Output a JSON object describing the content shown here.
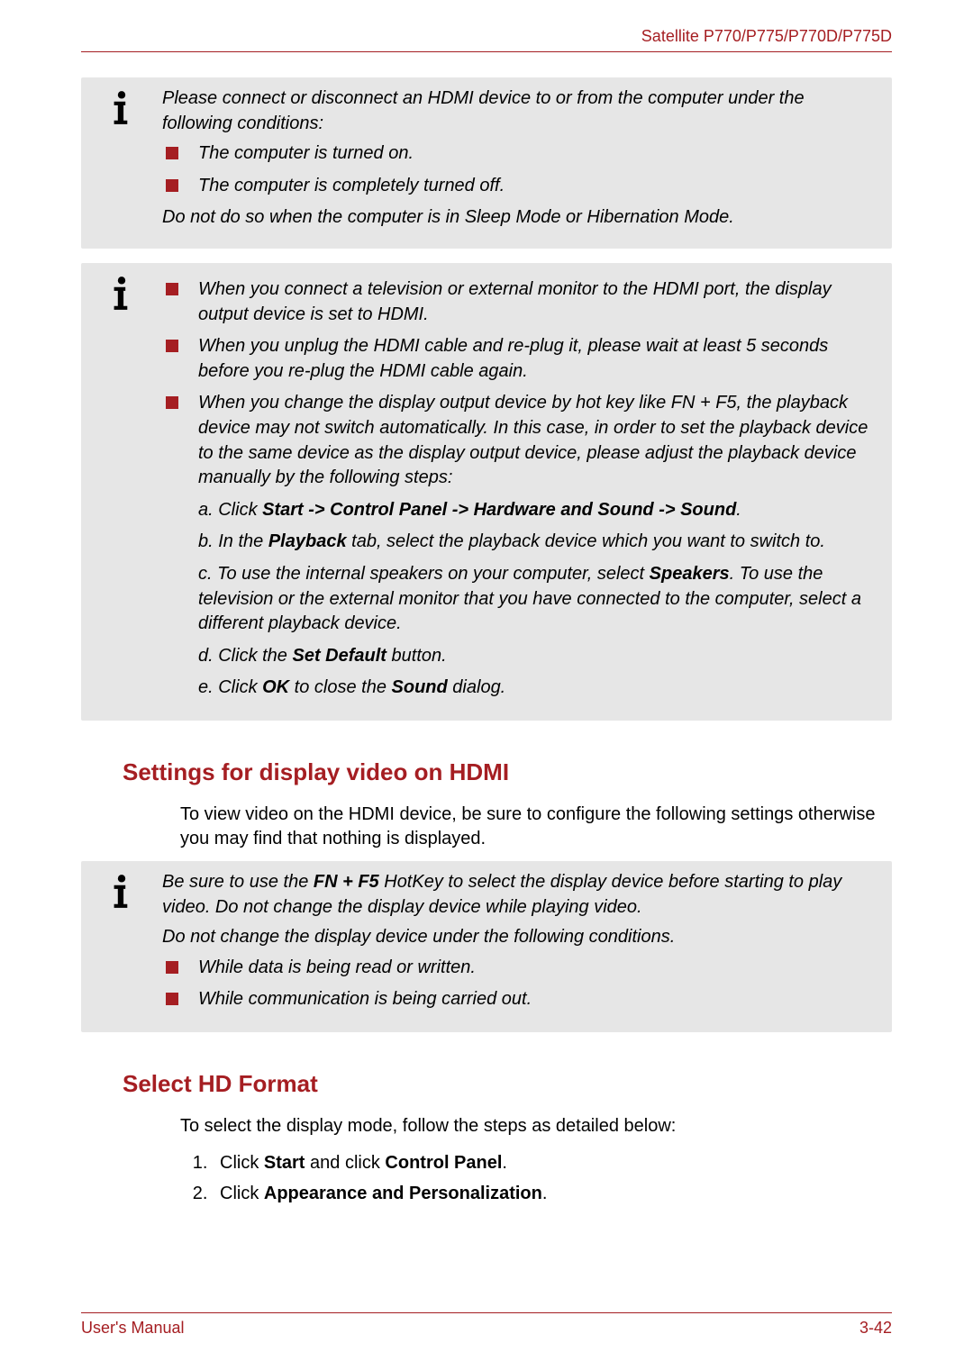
{
  "header": {
    "model": "Satellite P770/P775/P770D/P775D"
  },
  "info1": {
    "intro": "Please connect or disconnect an HDMI device to or from the computer under the following conditions:",
    "bullets": [
      "The computer is turned on.",
      "The computer is completely turned off."
    ],
    "outro": "Do not do so when the computer is in Sleep Mode or Hibernation Mode."
  },
  "info2": {
    "bullets": [
      "When you connect a television or external monitor to the HDMI port, the display output device is set to HDMI.",
      "When you unplug the HDMI cable and re-plug it, please wait at least 5 seconds before you re-plug the HDMI cable again.",
      "When you change the display output device by hot key like FN + F5, the playback device may not switch automatically. In this case, in order to set the playback device to the same device as the display output device, please adjust the playback device manually by the following steps:"
    ],
    "steps": {
      "a1": "a. Click ",
      "a2": "Start -> Control Panel -> Hardware and Sound -> Sound",
      "a3": ".",
      "b1": "b. In the ",
      "b2": "Playback",
      "b3": " tab, select the playback device which you want to switch to.",
      "c1": "c. To use the internal speakers on your computer, select ",
      "c2": "Speakers",
      "c3": ". To use the television or the external monitor that you have connected to the computer, select a different playback device.",
      "d1": "d. Click the ",
      "d2": "Set Default",
      "d3": " button.",
      "e1": "e. Click ",
      "e2": "OK",
      "e3": " to close the ",
      "e4": "Sound",
      "e5": " dialog."
    }
  },
  "section1": {
    "heading": "Settings for display video on HDMI",
    "body": "To view video on the HDMI device, be sure to configure the following settings otherwise you may find that nothing is displayed."
  },
  "info3": {
    "p1a": "Be sure to use the ",
    "p1b": "FN + F5",
    "p1c": " HotKey to select the display device before starting to play video. Do not change the display device while playing video.",
    "p2": "Do not change the display device under the following conditions.",
    "bullets": [
      "While data is being read or written.",
      "While communication is being carried out."
    ]
  },
  "section2": {
    "heading": "Select HD Format",
    "body": "To select the display mode, follow the steps as detailed below:",
    "list": {
      "i1a": "Click ",
      "i1b": "Start",
      "i1c": " and click ",
      "i1d": "Control Panel",
      "i1e": ".",
      "i2a": "Click ",
      "i2b": "Appearance and Personalization",
      "i2c": "."
    }
  },
  "footer": {
    "left": "User's Manual",
    "right": "3-42"
  }
}
